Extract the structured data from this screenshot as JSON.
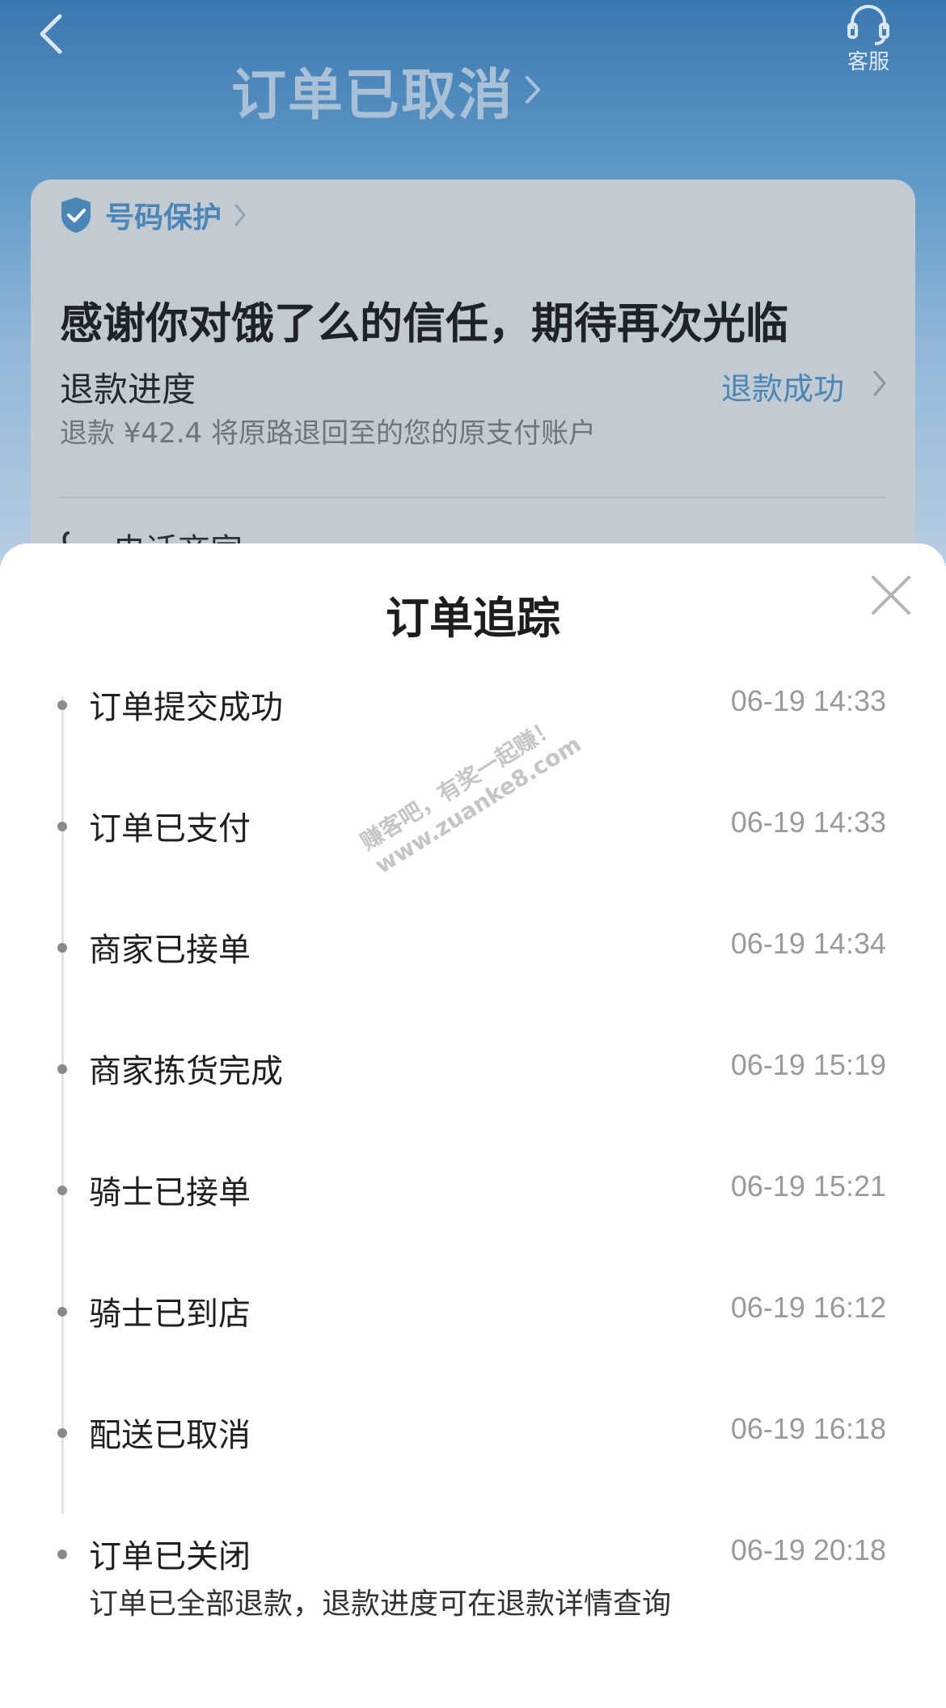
{
  "header": {
    "back_icon": "chevron-left-icon",
    "service_label": "客服",
    "status_title": "订单已取消"
  },
  "card": {
    "protect_label": "号码保护",
    "thanks_text": "感谢你对饿了么的信任，期待再次光临",
    "refund_label": "退款进度",
    "refund_status": "退款成功",
    "refund_desc": "退款 ¥42.4 将原路退回至的您的原支付账户",
    "call_label": "电话商家"
  },
  "sheet": {
    "title": "订单追踪",
    "events": [
      {
        "label": "订单提交成功",
        "time": "06-19 14:33"
      },
      {
        "label": "订单已支付",
        "time": "06-19 14:33"
      },
      {
        "label": "商家已接单",
        "time": "06-19 14:34"
      },
      {
        "label": "商家拣货完成",
        "time": "06-19 15:19"
      },
      {
        "label": "骑士已接单",
        "time": "06-19 15:21"
      },
      {
        "label": "骑士已到店",
        "time": "06-19 16:12"
      },
      {
        "label": "配送已取消",
        "time": "06-19 16:18"
      },
      {
        "label": "订单已关闭",
        "time": "06-19 20:18",
        "note": "订单已全部退款，退款进度可在退款详情查询"
      }
    ]
  },
  "watermark": {
    "line1": "赚客吧，有奖一起赚！",
    "line2": "www.zuanke8.com"
  },
  "colors": {
    "accent": "#4a86b8",
    "header_bg": "#3a78b0",
    "dot": "#8a8a8a"
  }
}
